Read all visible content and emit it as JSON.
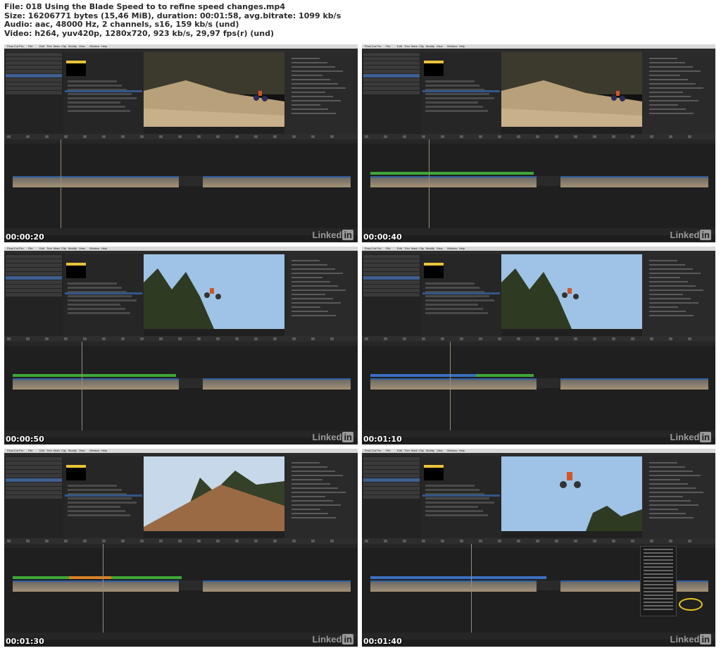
{
  "header": {
    "line1": "File: 018 Using the Blade Speed to to refine speed changes.mp4",
    "line2": "Size: 16206771 bytes (15,46 MiB), duration: 00:01:58, avg.bitrate: 1099 kb/s",
    "line3": "Audio: aac, 48000 Hz, 2 channels, s16, 159 kb/s (und)",
    "line4": "Video: h264, yuv420p, 1280x720, 923 kb/s, 29,97 fps(r) (und)"
  },
  "app": {
    "menu": [
      "Final Cut Pro",
      "File",
      "Edit",
      "Trim",
      "Mark",
      "Clip",
      "Modify",
      "View",
      "Window",
      "Help"
    ],
    "watermark": "Linked",
    "watermark_badge": "in"
  },
  "frames": [
    {
      "timestamp": "00:00:20",
      "scene": "dirt-jump",
      "speed_bar": "none"
    },
    {
      "timestamp": "00:00:40",
      "scene": "dirt-jump",
      "speed_bar": "green"
    },
    {
      "timestamp": "00:00:50",
      "scene": "sky-jump",
      "speed_bar": "green"
    },
    {
      "timestamp": "00:01:10",
      "scene": "sky-jump",
      "speed_bar": "blue-green"
    },
    {
      "timestamp": "00:01:30",
      "scene": "dirt-slope",
      "speed_bar": "green-orange"
    },
    {
      "timestamp": "00:01:40",
      "scene": "sky-high",
      "speed_bar": "blue",
      "popup_menu": true
    }
  ],
  "colors": {
    "speed_green": "#3fa83a",
    "speed_blue": "#3a6fc0",
    "speed_orange": "#d9822b",
    "playhead": "#e0493a",
    "highlight": "#e5c31d"
  }
}
